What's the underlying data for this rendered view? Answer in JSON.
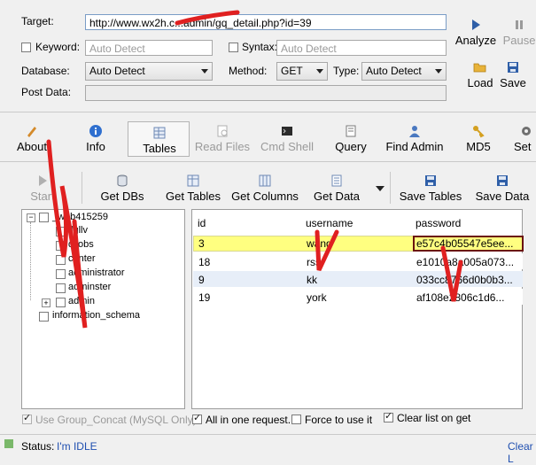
{
  "target": {
    "label": "Target:",
    "value": "http://www.wx2h.c...admin/gq_detail.php?id=39"
  },
  "keyword": {
    "label": "Keyword:",
    "placeholder": "Auto Detect"
  },
  "syntax": {
    "label": "Syntax:",
    "placeholder": "Auto Detect"
  },
  "database": {
    "label": "Database:",
    "value": "Auto Detect"
  },
  "method": {
    "label": "Method:",
    "value": "GET"
  },
  "type": {
    "label": "Type:",
    "value": "Auto Detect"
  },
  "post_data": {
    "label": "Post Data:",
    "value": ""
  },
  "actions": {
    "analyze": "Analyze",
    "pause": "Pause",
    "load": "Load",
    "save": "Save"
  },
  "tabs": [
    {
      "label": "About"
    },
    {
      "label": "Info"
    },
    {
      "label": "Tables"
    },
    {
      "label": "Read Files"
    },
    {
      "label": "Cmd Shell"
    },
    {
      "label": "Query"
    },
    {
      "label": "Find Admin"
    },
    {
      "label": "MD5"
    },
    {
      "label": "Set"
    }
  ],
  "toolbar": {
    "start": "Start",
    "get_dbs": "Get DBs",
    "get_tables": "Get Tables",
    "get_columns": "Get Columns",
    "get_data": "Get Data",
    "save_tables": "Save Tables",
    "save_data": "Save Data"
  },
  "tree": {
    "root": "_web415259",
    "items": [
      "flgllv",
      "dljobs",
      "center",
      "administrator",
      "adminster",
      "admin"
    ],
    "other": "information_schema"
  },
  "grid": {
    "columns": [
      "id",
      "username",
      "password"
    ],
    "rows": [
      [
        "3",
        "wang",
        "e57c4b05547e5ee..."
      ],
      [
        "18",
        "rss",
        "e1010a8a005a073..."
      ],
      [
        "9",
        "kk",
        "033cc8766d0b0b3..."
      ],
      [
        "19",
        "york",
        "af108e2806c1d6..."
      ]
    ]
  },
  "options": {
    "group_concat": "Use Group_Concat (MySQL Only)",
    "all_in_one": "All in one request.",
    "force": "Force to use it",
    "clear_list": "Clear list on get"
  },
  "status": {
    "label": "Status:",
    "value": "I'm IDLE",
    "clear": "Clear L"
  },
  "colors": {
    "highlight": "#ffff80",
    "accent": "#2a5aa0",
    "scribble": "#e02020"
  }
}
